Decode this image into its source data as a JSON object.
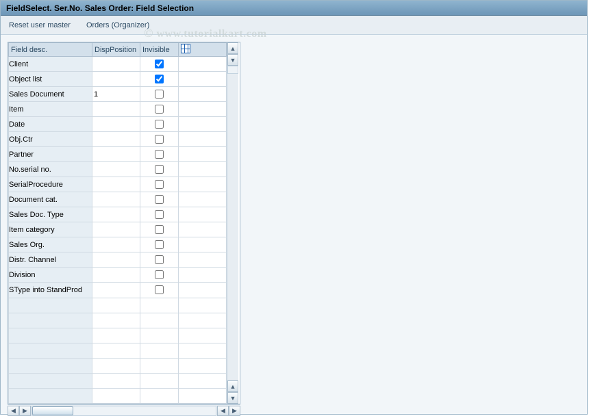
{
  "window": {
    "title": "FieldSelect. Ser.No. Sales Order: Field Selection"
  },
  "toolbar": {
    "reset_label": "Reset user master",
    "orders_label": "Orders (Organizer)"
  },
  "table": {
    "headers": {
      "desc": "Field desc.",
      "pos": "DispPosition",
      "inv": "Invisible"
    },
    "rows": [
      {
        "desc": "Client",
        "pos": "",
        "inv": true
      },
      {
        "desc": "Object list",
        "pos": "",
        "inv": true
      },
      {
        "desc": "Sales Document",
        "pos": "1",
        "inv": false
      },
      {
        "desc": "Item",
        "pos": "",
        "inv": false
      },
      {
        "desc": "Date",
        "pos": "",
        "inv": false
      },
      {
        "desc": "Obj.Ctr",
        "pos": "",
        "inv": false
      },
      {
        "desc": "Partner",
        "pos": "",
        "inv": false
      },
      {
        "desc": "No.serial no.",
        "pos": "",
        "inv": false
      },
      {
        "desc": "SerialProcedure",
        "pos": "",
        "inv": false
      },
      {
        "desc": "Document cat.",
        "pos": "",
        "inv": false
      },
      {
        "desc": "Sales Doc. Type",
        "pos": "",
        "inv": false
      },
      {
        "desc": "Item category",
        "pos": "",
        "inv": false
      },
      {
        "desc": "Sales Org.",
        "pos": "",
        "inv": false
      },
      {
        "desc": "Distr. Channel",
        "pos": "",
        "inv": false
      },
      {
        "desc": "Division",
        "pos": "",
        "inv": false
      },
      {
        "desc": "SType into StandProd",
        "pos": "",
        "inv": false
      }
    ],
    "empty_rows": 7
  },
  "watermark": "www.tutorialkart.com"
}
